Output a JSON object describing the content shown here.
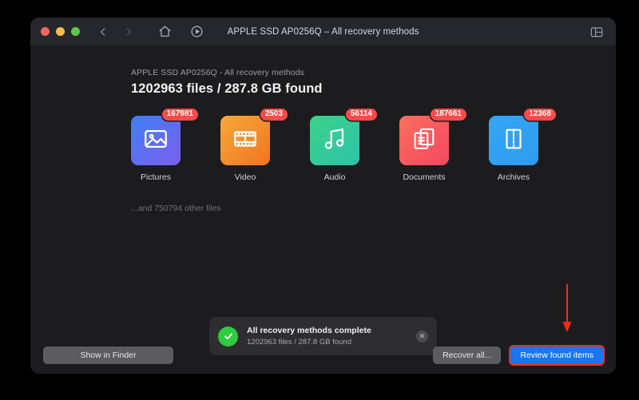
{
  "window": {
    "title": "APPLE SSD AP0256Q – All recovery methods",
    "traffic_lights": [
      "close",
      "minimize",
      "zoom"
    ],
    "toolbar": {
      "back_icon": "chevron-left-icon",
      "forward_icon": "chevron-right-icon",
      "home_icon": "home-icon",
      "history_icon": "history-icon",
      "panel_icon": "sidebar-toggle-icon"
    }
  },
  "main": {
    "subheading": "APPLE SSD AP0256Q - All recovery methods",
    "headline": "1202963 files / 287.8 GB found",
    "other_files": "...and 750794 other files",
    "categories": [
      {
        "label": "Pictures",
        "count": "167981",
        "icon": "picture-icon",
        "color_start": "#3f7ff0",
        "color_end": "#7c5ef0"
      },
      {
        "label": "Video",
        "count": "2503",
        "icon": "film-icon",
        "color_start": "#f7a93b",
        "color_end": "#f0741f"
      },
      {
        "label": "Audio",
        "count": "56114",
        "icon": "music-icon",
        "color_start": "#3ed18a",
        "color_end": "#2bc3a8"
      },
      {
        "label": "Documents",
        "count": "187661",
        "icon": "document-icon",
        "color_start": "#fb6f5e",
        "color_end": "#f4475f"
      },
      {
        "label": "Archives",
        "count": "12368",
        "icon": "archive-icon",
        "color_start": "#35a6f5",
        "color_end": "#2f9bf0"
      }
    ]
  },
  "toast": {
    "title": "All recovery methods complete",
    "subtitle": "1202963 files / 287.8 GB found",
    "status_icon": "check-circle-icon",
    "close_icon": "close-icon",
    "close_glyph": "✕",
    "accent_color": "#2fcb3f"
  },
  "footer": {
    "show_in_finder": "Show in Finder",
    "recover_all": "Recover all...",
    "review_found_items": "Review found items",
    "primary_color": "#1876f2"
  },
  "annotation": {
    "arrow_icon": "down-arrow-annotation",
    "color": "#ff2a16",
    "target": "review-found-items-button"
  }
}
